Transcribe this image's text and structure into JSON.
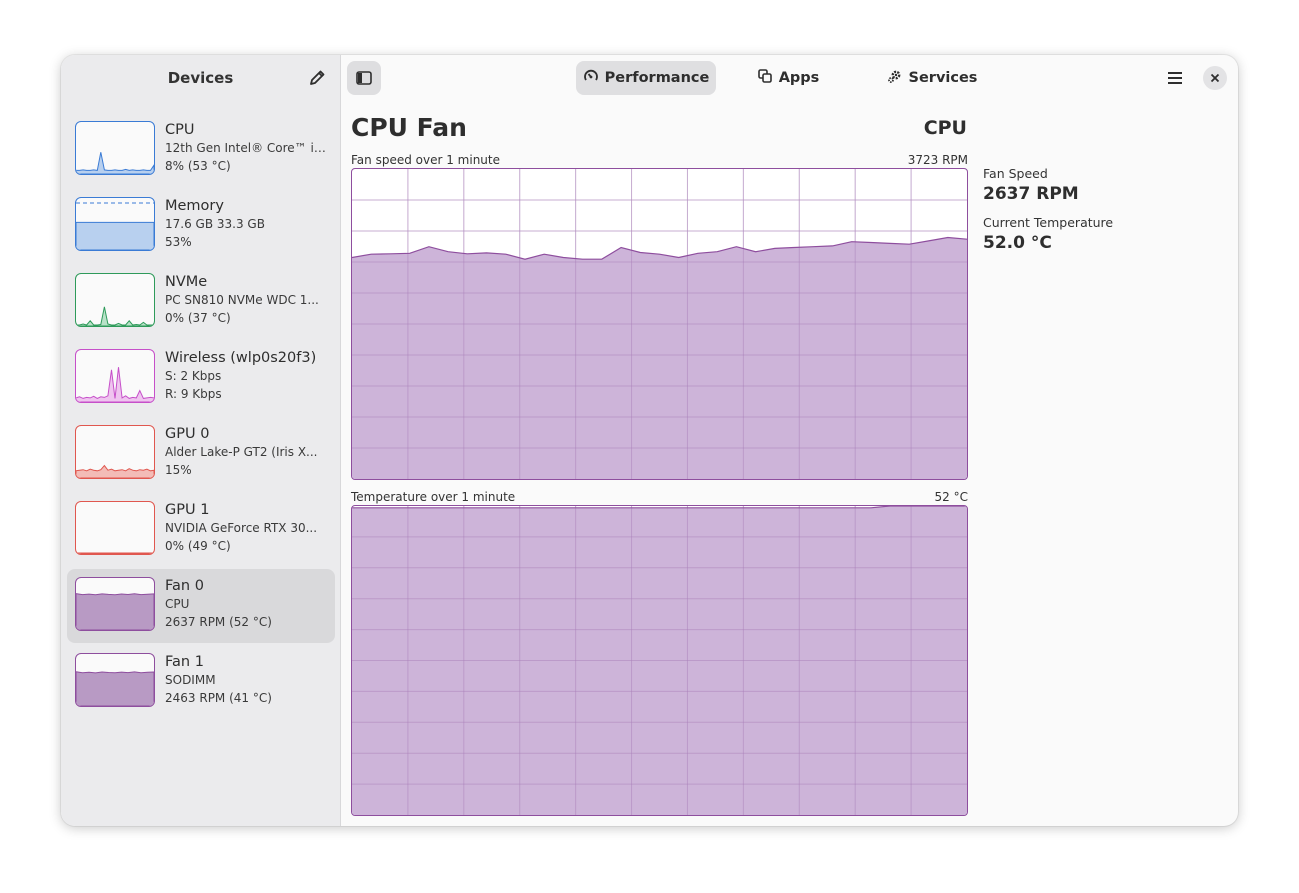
{
  "sidebar": {
    "title": "Devices",
    "edit_icon": "pencil-icon",
    "devices": [
      {
        "name": "CPU",
        "line1": "12th Gen Intel® Core™ i7-...",
        "line2": "8% (53 °C)",
        "color": "#3a7bd5",
        "fill": "#b8d0ef",
        "level": 0.08
      },
      {
        "name": "Memory",
        "line1": "17.6 GB 33.3 GB",
        "line2": "53%",
        "color": "#3a7bd5",
        "fill": "#b8d0ef",
        "level": 0.53
      },
      {
        "name": "NVMe",
        "line1": "PC SN810 NVMe WDC 1...",
        "line2": "0% (37 °C)",
        "color": "#2e9a5a",
        "fill": "#b8e2c8",
        "level": 0.0
      },
      {
        "name": "Wireless (wlp0s20f3)",
        "line1": "S: 2 Kbps",
        "line2": "R: 9 Kbps",
        "color": "#c64fc9",
        "fill": "#efc4ef",
        "level": 0.05
      },
      {
        "name": "GPU 0",
        "line1": "Alder Lake-P GT2 (Iris X...",
        "line2": "15%",
        "color": "#e0574f",
        "fill": "#f3bcb7",
        "level": 0.15
      },
      {
        "name": "GPU 1",
        "line1": "NVIDIA GeForce RTX 30...",
        "line2": "0% (49 °C)",
        "color": "#e0574f",
        "fill": "#f3bcb7",
        "level": 0.0
      },
      {
        "name": "Fan 0",
        "line1": "CPU",
        "line2": "2637 RPM (52 °C)",
        "color": "#8e4e9e",
        "fill": "#b89ac4",
        "level": 0.7,
        "selected": true
      },
      {
        "name": "Fan 1",
        "line1": "SODIMM",
        "line2": "2463 RPM (41 °C)",
        "color": "#8e4e9e",
        "fill": "#b89ac4",
        "level": 0.66
      }
    ]
  },
  "header": {
    "sidebar_toggle_icon": "sidebar-toggle-icon",
    "tabs": [
      {
        "label": "Performance",
        "icon": "speedometer-icon",
        "active": true
      },
      {
        "label": "Apps",
        "icon": "windows-icon",
        "active": false
      },
      {
        "label": "Services",
        "icon": "gears-icon",
        "active": false
      }
    ],
    "menu_icon": "hamburger-menu-icon",
    "close_icon": "close-icon"
  },
  "main": {
    "title": "CPU Fan",
    "subtitle": "CPU",
    "graph1": {
      "label": "Fan speed over 1 minute",
      "max_label": "3723 RPM",
      "color": "#8e4e9e",
      "fill": "#c9aed6",
      "max": 3723
    },
    "graph2": {
      "label": "Temperature over 1 minute",
      "max_label": "52 °C",
      "color": "#8e4e9e",
      "fill": "#c9aed6",
      "max": 52
    },
    "info": [
      {
        "label": "Fan Speed",
        "value": "2637 RPM"
      },
      {
        "label": "Current Temperature",
        "value": "52.0 °C"
      }
    ]
  },
  "chart_data": [
    {
      "type": "area",
      "title": "Fan speed over 1 minute",
      "ylabel": "",
      "ylim": [
        0,
        3723
      ],
      "y": [
        2660,
        2700,
        2705,
        2710,
        2790,
        2730,
        2705,
        2715,
        2700,
        2640,
        2700,
        2660,
        2640,
        2640,
        2780,
        2720,
        2700,
        2660,
        2710,
        2730,
        2790,
        2730,
        2770,
        2780,
        2790,
        2800,
        2850,
        2840,
        2830,
        2820,
        2860,
        2900,
        2880
      ]
    },
    {
      "type": "area",
      "title": "Temperature over 1 minute",
      "ylabel": "",
      "ylim": [
        0,
        52
      ],
      "y": [
        51.7,
        51.7,
        51.7,
        51.7,
        51.7,
        51.7,
        51.7,
        51.7,
        51.7,
        51.7,
        51.7,
        51.7,
        51.7,
        51.7,
        51.7,
        51.7,
        51.7,
        51.7,
        51.7,
        51.7,
        51.7,
        51.7,
        51.7,
        51.7,
        51.7,
        51.7,
        51.7,
        51.7,
        52,
        52,
        52,
        52,
        52
      ]
    }
  ]
}
